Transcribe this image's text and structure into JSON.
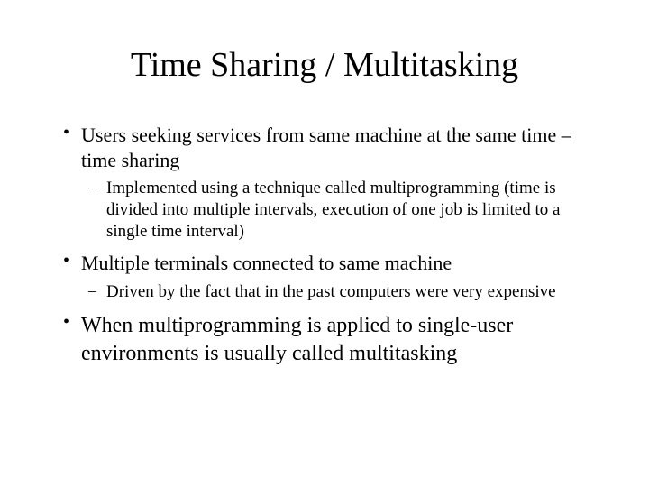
{
  "title": "Time Sharing / Multitasking",
  "bullets": {
    "b1": "Users seeking services from same machine at the same time – time sharing",
    "b1_sub1": "Implemented using a technique called multiprogramming (time is divided into multiple intervals, execution of one job is limited to a single time interval)",
    "b2": "Multiple terminals connected to same machine",
    "b2_sub1": "Driven by the fact that in the past computers were very expensive",
    "b3": "When multiprogramming is applied to single-user environments is usually called multitasking"
  }
}
